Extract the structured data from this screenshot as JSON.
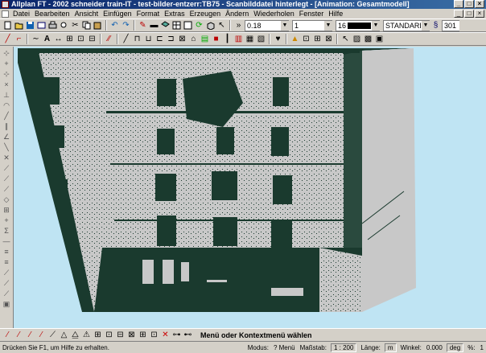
{
  "window": {
    "title": "Allplan FT - 2002 schneider train-IT - test-bilder-entzerr:TB75 - Scanbilddatei hinterlegt - [Animation: Gesamtmodell]",
    "minimize": "_",
    "maximize": "□",
    "close": "×"
  },
  "menu": {
    "items": [
      "Datei",
      "Bearbeiten",
      "Ansicht",
      "Einfügen",
      "Format",
      "Extras",
      "Erzeugen",
      "Ändern",
      "Wiederholen",
      "Fenster",
      "Hilfe"
    ]
  },
  "toolbar": {
    "pen_thickness": "0.18",
    "line_type": "1",
    "color_number": "16",
    "layer": "STANDARD",
    "format_number": "301"
  },
  "bottom": {
    "prompt": "Menü oder Kontextmenü wählen"
  },
  "status": {
    "help": "Drücken Sie F1, um Hilfe zu erhalten.",
    "modus_label": "Modus:",
    "modus_value": "? Menü",
    "massstab_label": "Maßstab:",
    "massstab_value": "1 : 200",
    "laenge_label": "Länge:",
    "laenge_value": "m",
    "winkel_label": "Winkel:",
    "winkel_value": "0.000",
    "winkel_unit": "deg",
    "percent_label": "%:",
    "percent_value": "1"
  },
  "colors": {
    "titlebar_start": "#0a246a",
    "titlebar_end": "#3a6ea5",
    "viewport_bg": "#bfe4f3",
    "photo_light": "#c8c8c8",
    "photo_dark": "#1a3a2e"
  }
}
